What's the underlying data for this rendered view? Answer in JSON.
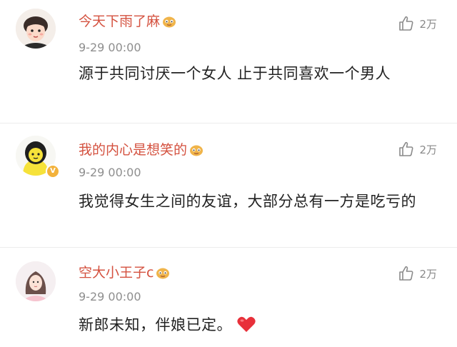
{
  "comments": [
    {
      "username": "今天下雨了麻",
      "time": "9-29 00:00",
      "text": "源于共同讨厌一个女人 止于共同喜欢一个男人",
      "likes": "2万",
      "avatar_icon": "girl-face-avatar-icon",
      "badge_icon": "emoji-badge-icon"
    },
    {
      "username": "我的内心是想笑的",
      "time": "9-29 00:00",
      "text": "我觉得女生之间的友谊，大部分总有一方是吃亏的",
      "likes": "2万",
      "avatar_icon": "yellow-hood-avatar-icon",
      "badge_icon": "emoji-badge-icon"
    },
    {
      "username": "空大小王子c",
      "time": "9-29 00:00",
      "text": "新郎未知，伴娘已定。",
      "likes": "2万",
      "avatar_icon": "girl-photo-avatar-icon",
      "badge_icon": "emoji-badge-icon",
      "trailing_icon": "red-heart-icon"
    }
  ],
  "colors": {
    "username": "#d4513f",
    "time": "#8e8e8e",
    "text": "#222222",
    "like": "#8a8a8a",
    "heart": "#e8303a"
  }
}
